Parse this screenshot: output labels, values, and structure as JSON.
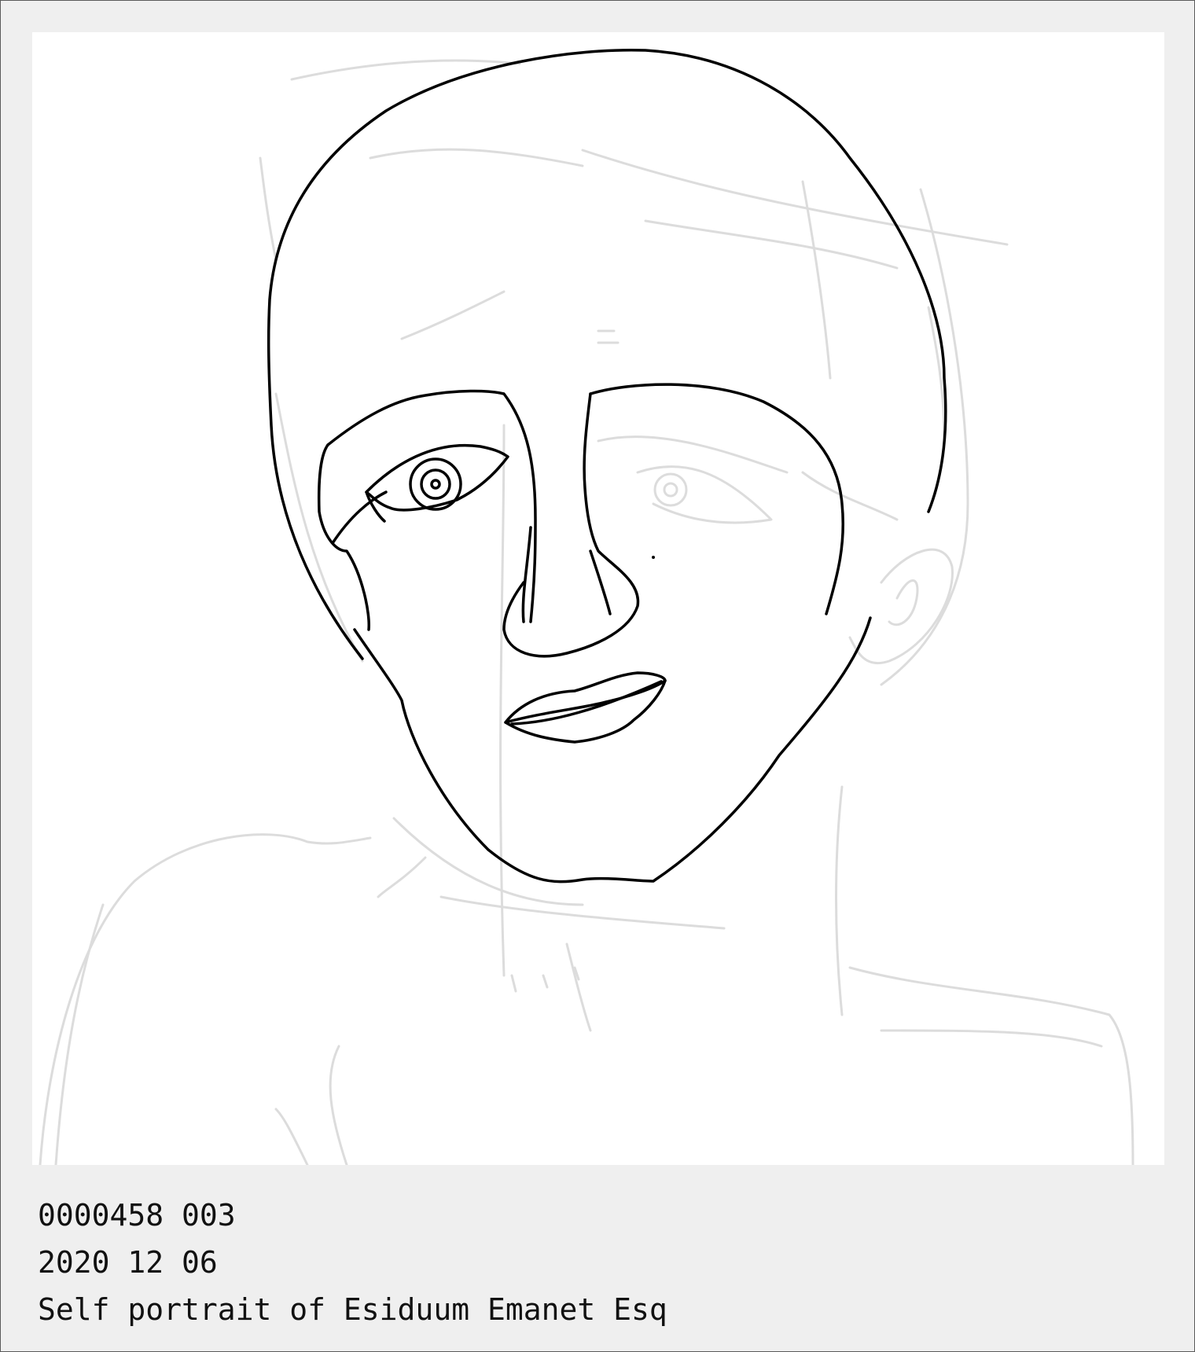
{
  "artwork": {
    "subject": "self-portrait line drawing",
    "icon": "portrait-drawing"
  },
  "caption": {
    "id_line": "0000458 003",
    "date_line": "2020 12 06",
    "title_line": "Self portrait of Esiduum Emanet Esq"
  },
  "colors": {
    "background": "#efefef",
    "canvas": "#ffffff",
    "ink": "#000000",
    "sketch": "#dcdcdc"
  }
}
